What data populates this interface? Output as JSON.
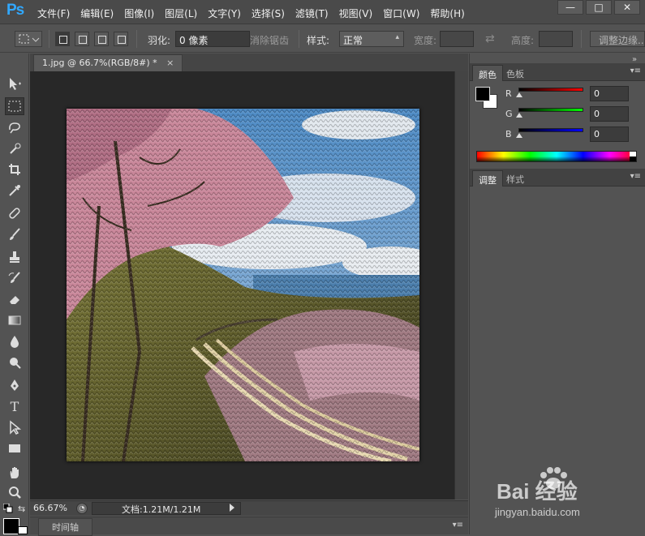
{
  "app": {
    "logo": "Ps",
    "menu": [
      "文件(F)",
      "编辑(E)",
      "图像(I)",
      "图层(L)",
      "文字(Y)",
      "选择(S)",
      "滤镜(T)",
      "视图(V)",
      "窗口(W)",
      "帮助(H)"
    ],
    "window_controls": {
      "minimize": "—",
      "maximize": "□",
      "close": "✕"
    }
  },
  "options": {
    "feather_label": "羽化:",
    "feather_value": "0 像素",
    "antialias_label": "消除锯齿",
    "style_label": "样式:",
    "style_value": "正常",
    "width_label": "宽度:",
    "height_label": "高度:",
    "refine_button": "调整边缘..."
  },
  "document": {
    "tab_title": "1.jpg @ 66.7%(RGB/8#) *",
    "tab_close": "×"
  },
  "status": {
    "zoom": "66.67%",
    "doc_info": "文档:1.21M/1.21M"
  },
  "timeline": {
    "tab": "时间轴"
  },
  "color_panel": {
    "tabs": [
      "颜色",
      "色板"
    ],
    "r_label": "R",
    "g_label": "G",
    "b_label": "B",
    "r_value": "0",
    "g_value": "0",
    "b_value": "0",
    "colors": {
      "red": "#ff0000",
      "green": "#00ff00",
      "blue": "#0000ff",
      "foreground": "#000000",
      "background": "#ffffff"
    }
  },
  "adjust_panel": {
    "tabs": [
      "调整",
      "样式"
    ]
  },
  "tools": [
    "move-icon",
    "marquee-icon",
    "lasso-icon",
    "quick-select-icon",
    "crop-icon",
    "eyedropper-icon",
    "healing-icon",
    "brush-icon",
    "stamp-icon",
    "history-brush-icon",
    "eraser-icon",
    "gradient-icon",
    "blur-icon",
    "dodge-icon",
    "pen-icon",
    "type-icon",
    "path-select-icon",
    "rectangle-icon",
    "hand-icon",
    "zoom-icon"
  ],
  "watermark": {
    "brand": "Bai 经验",
    "url": "jingyan.baidu.com"
  }
}
